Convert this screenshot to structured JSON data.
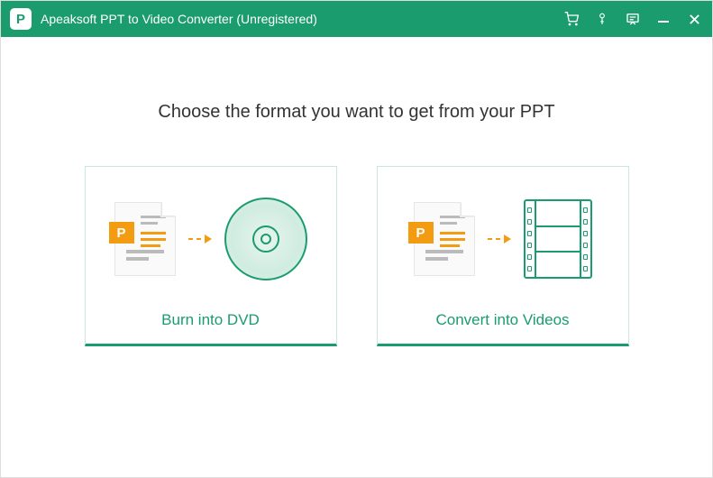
{
  "titlebar": {
    "title": "Apeaksoft PPT to Video Converter (Unregistered)"
  },
  "main": {
    "heading": "Choose the format you want to get from your PPT"
  },
  "cards": {
    "dvd": {
      "label": "Burn into DVD"
    },
    "video": {
      "label": "Convert into Videos"
    }
  },
  "colors": {
    "primary": "#1a9c6e",
    "accent": "#f39c12"
  }
}
